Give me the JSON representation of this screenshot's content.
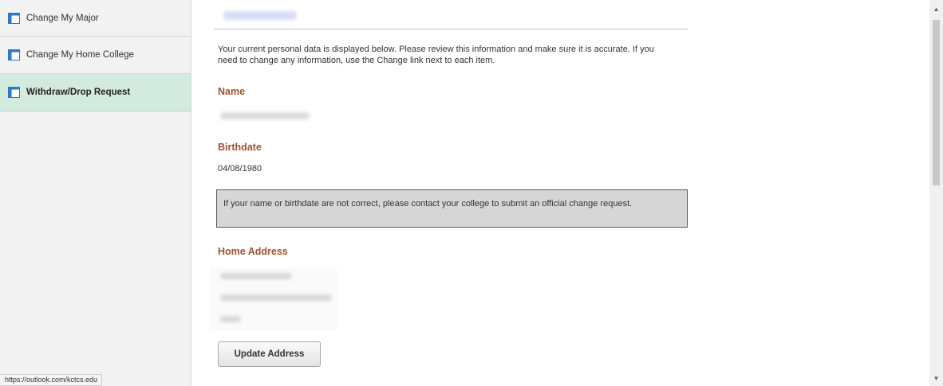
{
  "sidebar": {
    "items": [
      {
        "label": "Change My Major",
        "icon": "page-icon",
        "active": false
      },
      {
        "label": "Change My Home College",
        "icon": "page-icon",
        "active": false
      },
      {
        "label": "Withdraw/Drop Request",
        "icon": "page-icon",
        "active": true
      }
    ]
  },
  "status_bar": {
    "url": "https://outlook.com/kctcs.edu"
  },
  "main": {
    "intro": "Your current personal data is displayed below. Please review this information and make sure it is accurate.  If you need to change any information, use the Change link next to each item.",
    "name_label": "Name",
    "birthdate_label": "Birthdate",
    "birthdate_value": "04/08/1980",
    "notice": "If your name or birthdate are not correct, please contact your college to submit an official change request.",
    "home_address_label": "Home Address",
    "update_address_button": "Update Address"
  },
  "colors": {
    "section_label": "#a0522d",
    "active_nav_bg": "#d3eadf",
    "icon_blue": "#2f78c4"
  }
}
